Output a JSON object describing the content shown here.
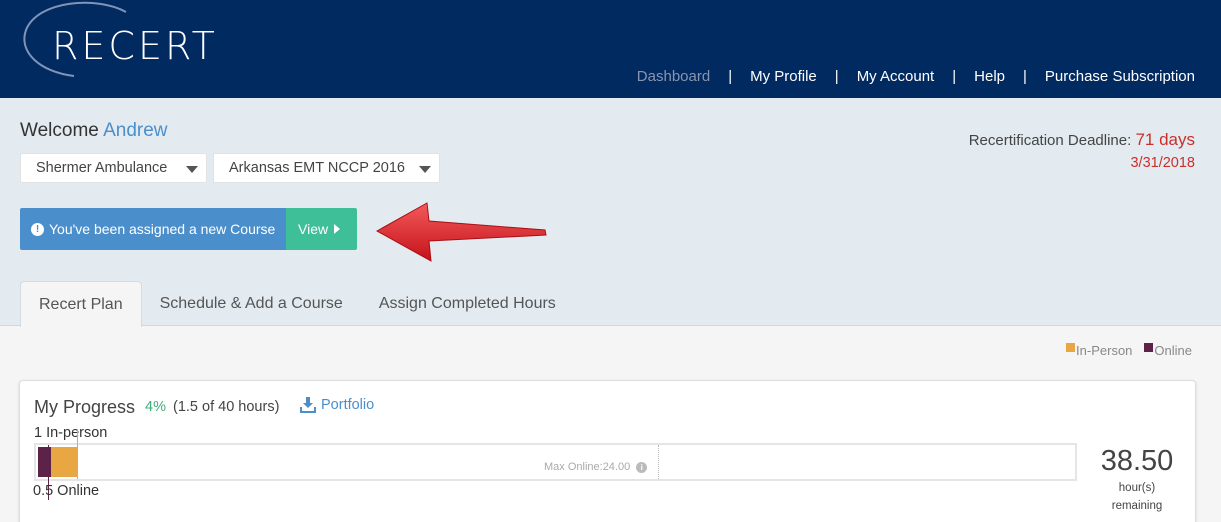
{
  "header": {
    "logo_text": "RECERT",
    "nav": [
      {
        "label": "Dashboard",
        "active": true
      },
      {
        "label": "My Profile",
        "active": false
      },
      {
        "label": "My Account",
        "active": false
      },
      {
        "label": "Help",
        "active": false
      },
      {
        "label": "Purchase Subscription",
        "active": false
      }
    ],
    "separator": "|"
  },
  "welcome": {
    "greeting": "Welcome",
    "name": "Andrew"
  },
  "selects": {
    "organization": "Shermer Ambulance",
    "program": "Arkansas EMT NCCP 2016"
  },
  "deadline": {
    "label": "Recertification Deadline:",
    "days": "71 days",
    "date": "3/31/2018"
  },
  "alert": {
    "info_icon": "!",
    "message": "You've been assigned a new Course",
    "button_label": "View"
  },
  "tabs": [
    {
      "label": "Recert Plan",
      "active": true
    },
    {
      "label": "Schedule & Add a Course",
      "active": false
    },
    {
      "label": "Assign Completed Hours",
      "active": false
    }
  ],
  "legend": {
    "in_person": {
      "label": "In-Person",
      "color": "#e9a743"
    },
    "online": {
      "label": "Online",
      "color": "#5c2247"
    }
  },
  "progress": {
    "title": "My Progress",
    "percent": "4%",
    "hours_text": "(1.5 of 40 hours)",
    "portfolio_label": "Portfolio",
    "in_person_label": "1 In-person",
    "online_label": "0.5 Online",
    "max_online_label": "Max Online:24.00",
    "max_online_info": "i",
    "in_person_hours": 1,
    "online_hours": 0.5,
    "total_hours": 40,
    "max_online_hours": 24,
    "remaining_value": "38.50",
    "remaining_unit": "hour(s)",
    "remaining_label": "remaining"
  },
  "colors": {
    "header_bg": "#012a60",
    "accent_blue": "#4a8fcb",
    "accent_green": "#3fbf97",
    "deadline_red": "#c9302c"
  }
}
